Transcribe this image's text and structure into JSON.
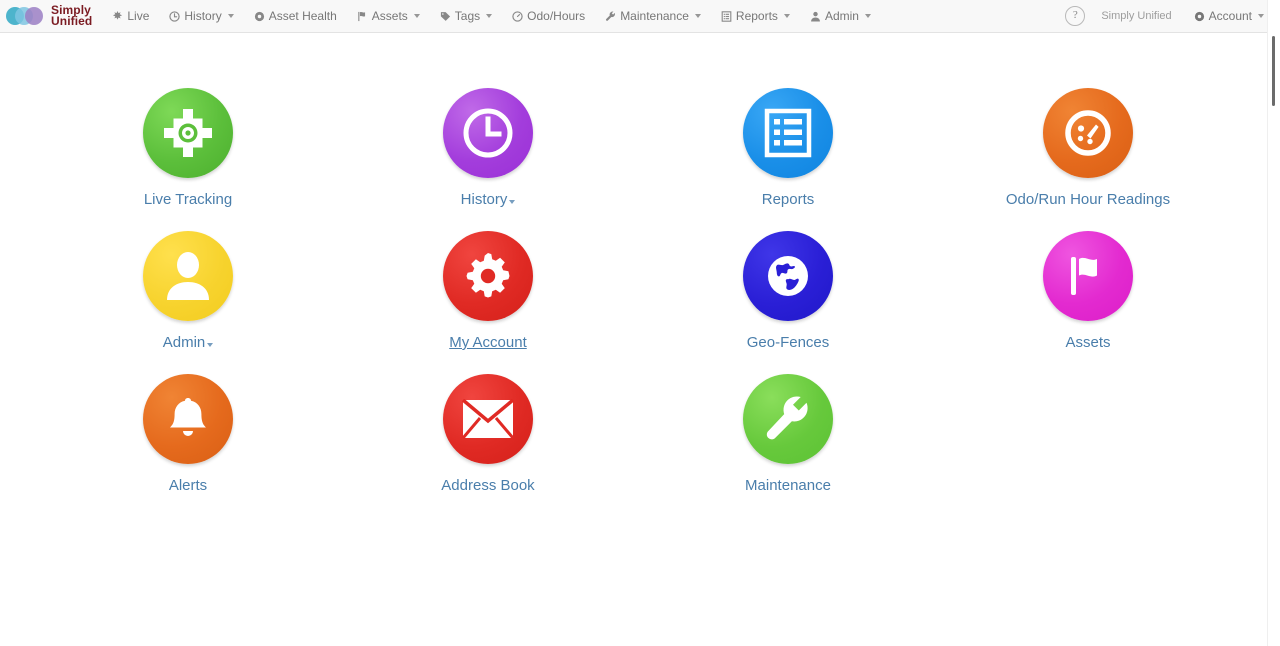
{
  "app": {
    "brand_name_line1": "Simply",
    "brand_name_line2": "Unified"
  },
  "navbar": {
    "items": [
      {
        "label": "Live",
        "icon": "compass-icon",
        "caret": false
      },
      {
        "label": "History",
        "icon": "clock-icon",
        "caret": true
      },
      {
        "label": "Asset Health",
        "icon": "gear-icon",
        "caret": false
      },
      {
        "label": "Assets",
        "icon": "flag-icon",
        "caret": true
      },
      {
        "label": "Tags",
        "icon": "tag-icon",
        "caret": true
      },
      {
        "label": "Odo/Hours",
        "icon": "gauge-icon",
        "caret": false
      },
      {
        "label": "Maintenance",
        "icon": "wrench-icon",
        "caret": true
      },
      {
        "label": "Reports",
        "icon": "report-icon",
        "caret": true
      },
      {
        "label": "Admin",
        "icon": "user-icon",
        "caret": true
      }
    ],
    "help_label": "?",
    "help_icon": "help-circle-icon",
    "user_name": "Simply Unified",
    "account_label": "Account",
    "account_icon": "gear-icon",
    "account_caret": true
  },
  "tiles": [
    {
      "label": "Live Tracking",
      "icon": "crosshair-target-icon",
      "color": "#5cbf3b",
      "caret": false,
      "hover": false
    },
    {
      "label": "History",
      "icon": "clock-icon",
      "color": "#a33ddc",
      "caret": true,
      "hover": false
    },
    {
      "label": "Reports",
      "icon": "report-list-icon",
      "color": "#1a8fe8",
      "caret": false,
      "hover": false
    },
    {
      "label": "Odo/Run Hour Readings",
      "icon": "gauge-icon",
      "color": "#e56a1d",
      "caret": false,
      "hover": false
    },
    {
      "label": "Admin",
      "icon": "user-icon",
      "color": "#f7d32e",
      "caret": true,
      "hover": false
    },
    {
      "label": "My Account",
      "icon": "gear-icon",
      "color": "#e02a24",
      "caret": false,
      "hover": true
    },
    {
      "label": "Geo-Fences",
      "icon": "globe-icon",
      "color": "#2a1fd6",
      "caret": false,
      "hover": false
    },
    {
      "label": "Assets",
      "icon": "flag-icon",
      "color": "#e32ad0",
      "caret": false,
      "hover": false
    },
    {
      "label": "Alerts",
      "icon": "bell-icon",
      "color": "#e56a1d",
      "caret": false,
      "hover": false
    },
    {
      "label": "Address Book",
      "icon": "envelope-icon",
      "color": "#e02a24",
      "caret": false,
      "hover": false
    },
    {
      "label": "Maintenance",
      "icon": "wrench-icon",
      "color": "#67c93c",
      "caret": false,
      "hover": false
    }
  ],
  "scrollbar": {
    "thumb_top_percent": 6
  }
}
